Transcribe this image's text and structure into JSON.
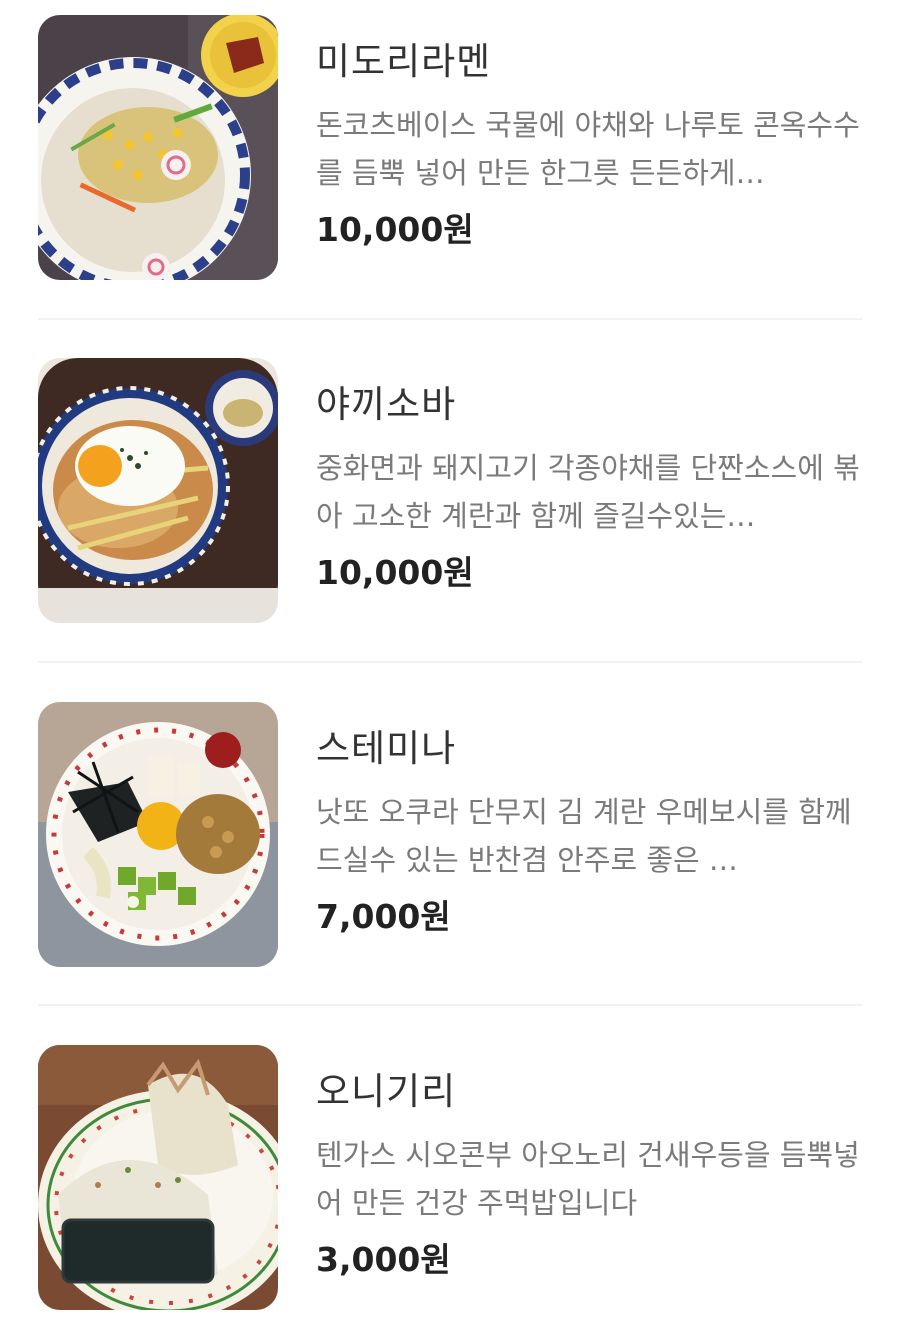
{
  "menu": {
    "items": [
      {
        "name": "미도리라멘",
        "description": "돈코츠베이스 국물에 야채와 나루토 콘옥수수를 듬뿍 넣어 만든 한그릇 든든하게…",
        "price": "10,000원",
        "image_icon": "ramen-bowl-photo"
      },
      {
        "name": "야끼소바",
        "description": "중화면과 돼지고기 각종야채를 단짠소스에 볶아 고소한 계란과 함께 즐길수있는…",
        "price": "10,000원",
        "image_icon": "yakisoba-plate-photo"
      },
      {
        "name": "스테미나",
        "description": "낫또 오쿠라 단무지 김 계란 우메보시를 함께 드실수 있는 반찬겸 안주로 좋은 …",
        "price": "7,000원",
        "image_icon": "stamina-bowl-photo"
      },
      {
        "name": "오니기리",
        "description": "텐가스 시오콘부 아오노리 건새우등을 듬뿍넣어 만든 건강 주먹밥입니다",
        "price": "3,000원",
        "image_icon": "onigiri-plate-photo"
      }
    ]
  },
  "colors": {
    "title": "#333333",
    "description": "#7a7a7a",
    "price": "#222222",
    "divider": "#f1f1f1"
  }
}
